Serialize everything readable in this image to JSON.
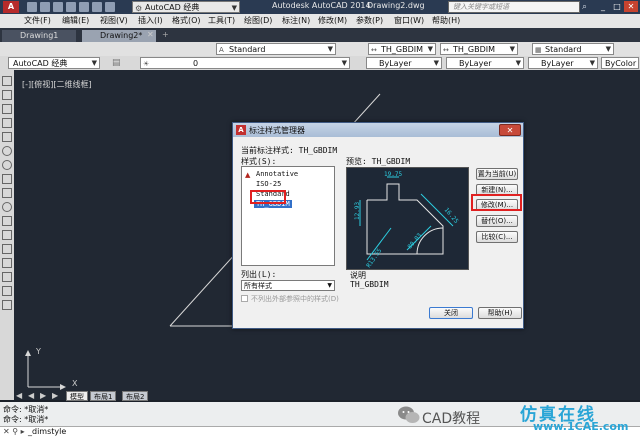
{
  "titlebar": {
    "workspace": "AutoCAD 经典",
    "app_title": "Autodesk AutoCAD 2014",
    "doc_title": "Drawing2.dwg",
    "search_placeholder": "键入关键字或短语"
  },
  "menu": [
    "文件(F)",
    "编辑(E)",
    "视图(V)",
    "插入(I)",
    "格式(O)",
    "工具(T)",
    "绘图(D)",
    "标注(N)",
    "修改(M)",
    "参数(P)",
    "窗口(W)",
    "帮助(H)"
  ],
  "tabs": [
    {
      "label": "Drawing1",
      "active": false
    },
    {
      "label": "Drawing2*",
      "active": true
    }
  ],
  "style_toolbar": {
    "text_style": "Standard",
    "dim_style": "TH_GBDIM",
    "dim_style2": "TH_GBDIM",
    "table_style": "Standard",
    "multileader_style": "Standard"
  },
  "layer_toolbar": {
    "workspace": "AutoCAD 经典",
    "layer_name": "0",
    "color": "ByLayer",
    "linetype": "ByLayer",
    "lineweight": "ByLayer",
    "plotstyle": "ByColor"
  },
  "canvas": {
    "viewport_label": "[-][俯视][二维线框]",
    "ucs_x": "X",
    "ucs_y": "Y",
    "watermark": "1CAE.COM"
  },
  "layout_tabs": [
    "模型",
    "布局1",
    "布局2"
  ],
  "command": {
    "lines": [
      "命令: *取消*",
      "命令: *取消*"
    ],
    "input": "_dimstyle"
  },
  "watermark": {
    "wechat_text": "CAD教程",
    "site_cn": "仿真在线",
    "site": "www.1CAE.com"
  },
  "dialog": {
    "title": "标注样式管理器",
    "current_style_label": "当前标注样式: TH_GBDIM",
    "styles_label": "样式(S):",
    "styles": [
      "Annotative",
      "ISO-25",
      "Standard",
      "TH_GBDIM"
    ],
    "preview_label": "预览: TH_GBDIM",
    "list_label": "列出(L):",
    "list_value": "所有样式",
    "xref_checkbox": "不列出外部参照中的样式(D)",
    "description_label": "说明",
    "description": "TH_GBDIM",
    "buttons": {
      "set_current": "置为当前(U)",
      "new": "新建(N)...",
      "modify": "修改(M)...",
      "override": "替代(O)...",
      "compare": "比较(C)...",
      "close": "关闭",
      "help": "帮助(H)"
    },
    "preview_dims": {
      "top": "19.75",
      "left": "12.93",
      "right": "16.25",
      "angle": "80.03",
      "bottom": "R13.55"
    }
  },
  "colors": {
    "accent_red": "#e02020",
    "selection": "#3270c8",
    "preview_dim": "#2ccde0"
  }
}
